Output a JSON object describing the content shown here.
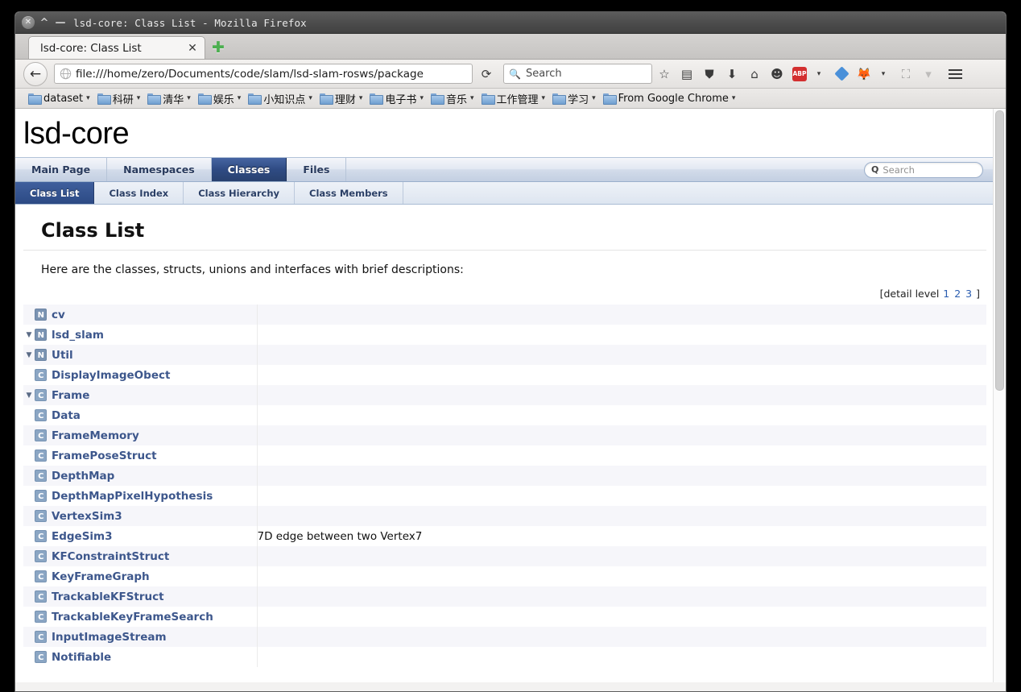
{
  "window": {
    "title": "lsd-core: Class List - Mozilla Firefox",
    "close_glyph": "✕",
    "maximize_glyph": "^",
    "minimize_glyph": "—"
  },
  "browser": {
    "tab": {
      "label": "lsd-core: Class List",
      "close_glyph": "✕"
    },
    "new_tab_glyph": "✚",
    "back_glyph": "←",
    "url": "file:///home/zero/Documents/code/slam/lsd-slam-rosws/package",
    "reload_glyph": "⟳",
    "search_placeholder": "Search",
    "search_magnifier": "🔍",
    "toolbar_icons": [
      {
        "name": "bookmark-star-icon",
        "glyph": "☆"
      },
      {
        "name": "reader-list-icon",
        "glyph": "▤"
      },
      {
        "name": "pocket-icon",
        "glyph": "⛉"
      },
      {
        "name": "downloads-icon",
        "glyph": "⬇"
      },
      {
        "name": "home-icon",
        "glyph": "⌂"
      },
      {
        "name": "hello-chat-icon",
        "glyph": "☺"
      },
      {
        "name": "adblockplus-icon",
        "glyph": "ABP"
      },
      {
        "name": "diamond-addon-icon",
        "glyph": "◆"
      },
      {
        "name": "firefox-addon-icon",
        "glyph": "🦊"
      },
      {
        "name": "screenshot-icon",
        "glyph": "⛶"
      }
    ],
    "menu_glyph": "☰",
    "bookmarks": [
      {
        "label": "dataset",
        "caret": "▾"
      },
      {
        "label": "科研",
        "caret": "▾"
      },
      {
        "label": "清华",
        "caret": "▾"
      },
      {
        "label": "娱乐",
        "caret": "▾"
      },
      {
        "label": "小知识点",
        "caret": "▾"
      },
      {
        "label": "理财",
        "caret": "▾"
      },
      {
        "label": "电子书",
        "caret": "▾"
      },
      {
        "label": "音乐",
        "caret": "▾"
      },
      {
        "label": "工作管理",
        "caret": "▾"
      },
      {
        "label": "学习",
        "caret": "▾"
      },
      {
        "label": "From Google Chrome",
        "caret": "▾"
      }
    ]
  },
  "doxygen": {
    "project_name": "lsd-core",
    "main_tabs": [
      {
        "label": "Main Page",
        "current": false
      },
      {
        "label": "Namespaces",
        "current": false
      },
      {
        "label": "Classes",
        "current": true
      },
      {
        "label": "Files",
        "current": false
      }
    ],
    "sub_tabs": [
      {
        "label": "Class List",
        "current": true
      },
      {
        "label": "Class Index",
        "current": false
      },
      {
        "label": "Class Hierarchy",
        "current": false
      },
      {
        "label": "Class Members",
        "current": false
      }
    ],
    "search_placeholder": "Search",
    "search_icon_glyph": "Q",
    "page_title": "Class List",
    "description": "Here are the classes, structs, unions and interfaces with brief descriptions:",
    "detail_level_label": "[detail level",
    "detail_levels": [
      "1",
      "2",
      "3"
    ],
    "detail_level_close": "]",
    "rows": [
      {
        "indent": 0,
        "arrow": "",
        "icon": "N",
        "name": "cv",
        "desc": ""
      },
      {
        "indent": 0,
        "arrow": "▼",
        "icon": "N",
        "name": "lsd_slam",
        "desc": ""
      },
      {
        "indent": 1,
        "arrow": "▼",
        "icon": "N",
        "name": "Util",
        "desc": ""
      },
      {
        "indent": 2,
        "arrow": "",
        "icon": "C",
        "name": "DisplayImageObect",
        "desc": ""
      },
      {
        "indent": 1,
        "arrow": "▼",
        "icon": "C",
        "name": "Frame",
        "desc": ""
      },
      {
        "indent": 2,
        "arrow": "",
        "icon": "C",
        "name": "Data",
        "desc": ""
      },
      {
        "indent": 1,
        "arrow": "",
        "icon": "C",
        "name": "FrameMemory",
        "desc": ""
      },
      {
        "indent": 1,
        "arrow": "",
        "icon": "C",
        "name": "FramePoseStruct",
        "desc": ""
      },
      {
        "indent": 1,
        "arrow": "",
        "icon": "C",
        "name": "DepthMap",
        "desc": ""
      },
      {
        "indent": 1,
        "arrow": "",
        "icon": "C",
        "name": "DepthMapPixelHypothesis",
        "desc": ""
      },
      {
        "indent": 1,
        "arrow": "",
        "icon": "C",
        "name": "VertexSim3",
        "desc": ""
      },
      {
        "indent": 1,
        "arrow": "",
        "icon": "C",
        "name": "EdgeSim3",
        "desc": "7D edge between two Vertex7"
      },
      {
        "indent": 1,
        "arrow": "",
        "icon": "C",
        "name": "KFConstraintStruct",
        "desc": ""
      },
      {
        "indent": 1,
        "arrow": "",
        "icon": "C",
        "name": "KeyFrameGraph",
        "desc": ""
      },
      {
        "indent": 1,
        "arrow": "",
        "icon": "C",
        "name": "TrackableKFStruct",
        "desc": ""
      },
      {
        "indent": 1,
        "arrow": "",
        "icon": "C",
        "name": "TrackableKeyFrameSearch",
        "desc": ""
      },
      {
        "indent": 1,
        "arrow": "",
        "icon": "C",
        "name": "InputImageStream",
        "desc": ""
      },
      {
        "indent": 1,
        "arrow": "",
        "icon": "C",
        "name": "Notifiable",
        "desc": ""
      }
    ]
  },
  "colors": {
    "accent_blue": "#2c4a84",
    "link_blue": "#3d578c",
    "namespace_icon": "#7a93b2",
    "class_icon": "#8ba6c4",
    "row_stripe": "#f6f6fa"
  }
}
